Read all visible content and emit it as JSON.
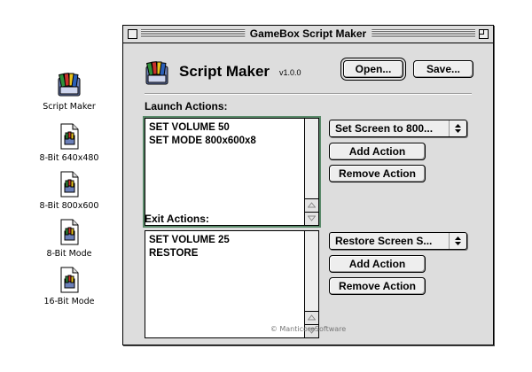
{
  "desktop_icons": [
    {
      "label": "Script Maker",
      "icon": "script-maker-app-icon"
    },
    {
      "label": "8-Bit 640x480",
      "icon": "script-document-icon"
    },
    {
      "label": "8-Bit 800x600",
      "icon": "script-document-icon"
    },
    {
      "label": "8-Bit Mode",
      "icon": "script-document-icon"
    },
    {
      "label": "16-Bit Mode",
      "icon": "script-document-icon"
    }
  ],
  "window": {
    "title": "GameBox Script Maker",
    "app_title": "Script Maker",
    "version": "v1.0.0",
    "open_label": "Open...",
    "save_label": "Save...",
    "copyright": "© ManticoreSoftware"
  },
  "launch": {
    "label": "Launch Actions:",
    "lines": [
      "SET VOLUME 50",
      "SET MODE 800x600x8"
    ],
    "popup_selected": "Set Screen to 800...",
    "add_label": "Add Action",
    "remove_label": "Remove Action"
  },
  "exit": {
    "label": "Exit Actions:",
    "lines": [
      "SET VOLUME 25",
      "RESTORE"
    ],
    "popup_selected": "Restore Screen S...",
    "add_label": "Add Action",
    "remove_label": "Remove Action"
  },
  "colors": {
    "window_bg": "#dddddd",
    "focus_ring": "#5a8a6a"
  }
}
